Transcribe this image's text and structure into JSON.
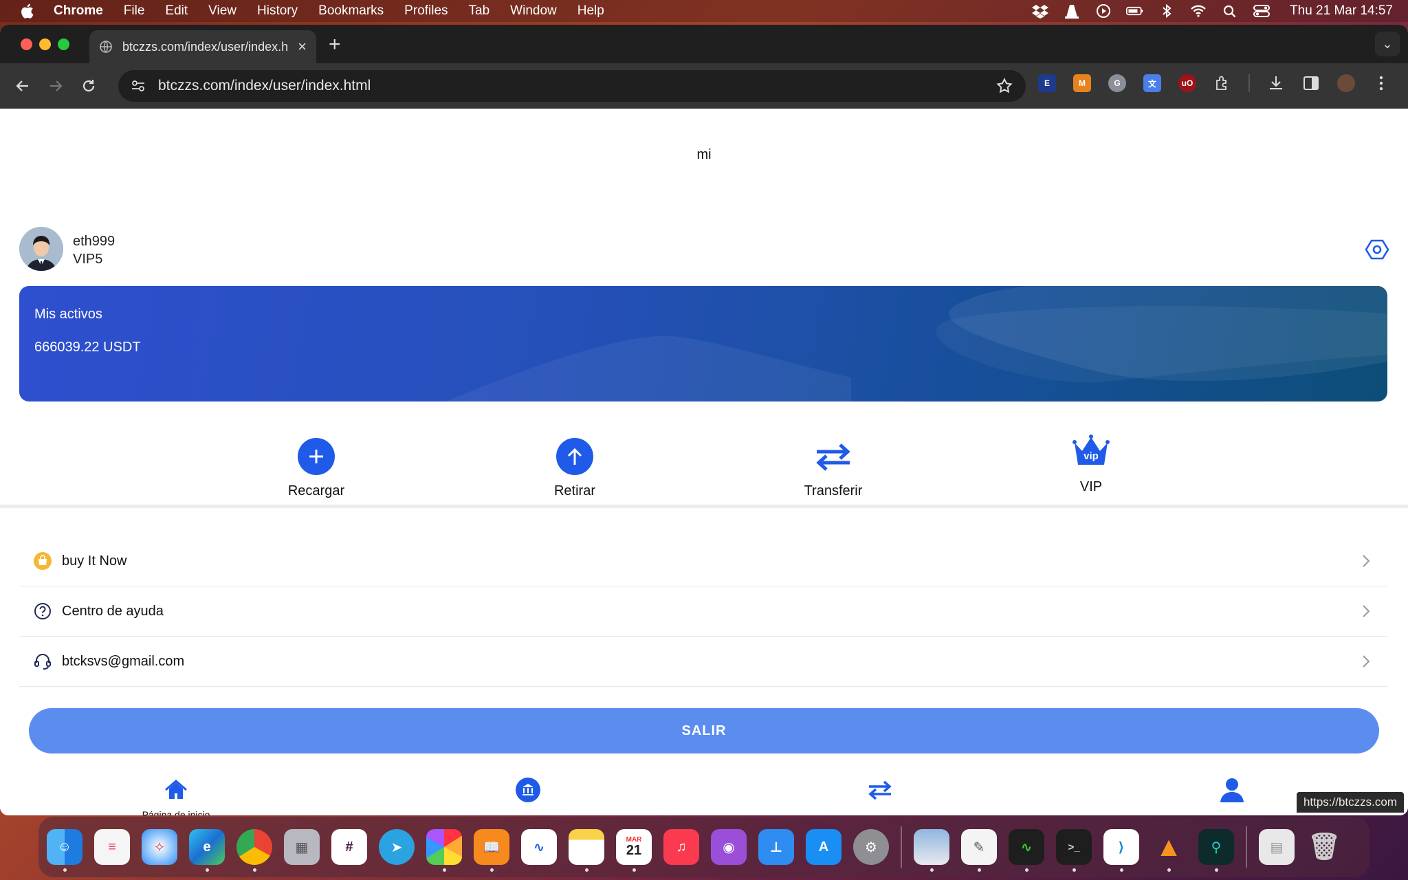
{
  "menubar": {
    "app_name": "Chrome",
    "items": [
      "File",
      "Edit",
      "View",
      "History",
      "Bookmarks",
      "Profiles",
      "Tab",
      "Window",
      "Help"
    ],
    "clock": "Thu 21 Mar  14:57"
  },
  "browser": {
    "tab_title": "btczzs.com/index/user/index.h",
    "url": "btczzs.com/index/user/index.html",
    "status_url": "https://btczzs.com"
  },
  "page": {
    "title": "mi",
    "user": {
      "name": "eth999",
      "level": "VIP5"
    },
    "assets": {
      "title": "Mis activos",
      "value": "666039.22 USDT"
    },
    "actions": [
      {
        "label": "Recargar",
        "icon": "plus-circle-icon"
      },
      {
        "label": "Retirar",
        "icon": "arrow-up-circle-icon"
      },
      {
        "label": "Transferir",
        "icon": "transfer-arrows-icon"
      },
      {
        "label": "VIP",
        "icon": "vip-crown-icon"
      }
    ],
    "menu": [
      {
        "label": "buy It Now",
        "icon": "shop-icon"
      },
      {
        "label": "Centro de ayuda",
        "icon": "help-circle-icon"
      },
      {
        "label": "btcksvs@gmail.com",
        "icon": "headset-icon"
      }
    ],
    "logout_label": "SALIR",
    "bottom_nav": [
      {
        "label": "Página de inicio",
        "icon": "home-icon"
      },
      {
        "label": "",
        "icon": "bank-icon"
      },
      {
        "label": "",
        "icon": "transfer-arrows-icon"
      },
      {
        "label": "",
        "icon": "user-icon"
      }
    ]
  },
  "colors": {
    "accent": "#1f5be8",
    "logout_button": "#5b8def",
    "card_gradient_start": "#2e4fcf",
    "card_gradient_end": "#0d4e78"
  },
  "dock": {
    "apps": [
      "Finder",
      "Reminders",
      "Safari",
      "Edge",
      "Chrome",
      "Launchpad",
      "Slack",
      "Telegram",
      "Photos",
      "Books",
      "Freeform",
      "Notes",
      "Calendar",
      "Music",
      "Podcasts",
      "Keynote",
      "App Store",
      "System Settings",
      "Preview",
      "TextEdit",
      "Activity Monitor",
      "Terminal",
      "VS Code",
      "VLC",
      "GitKraken",
      "Documents",
      "Trash"
    ],
    "calendar_month": "MAR",
    "calendar_day": "21"
  }
}
